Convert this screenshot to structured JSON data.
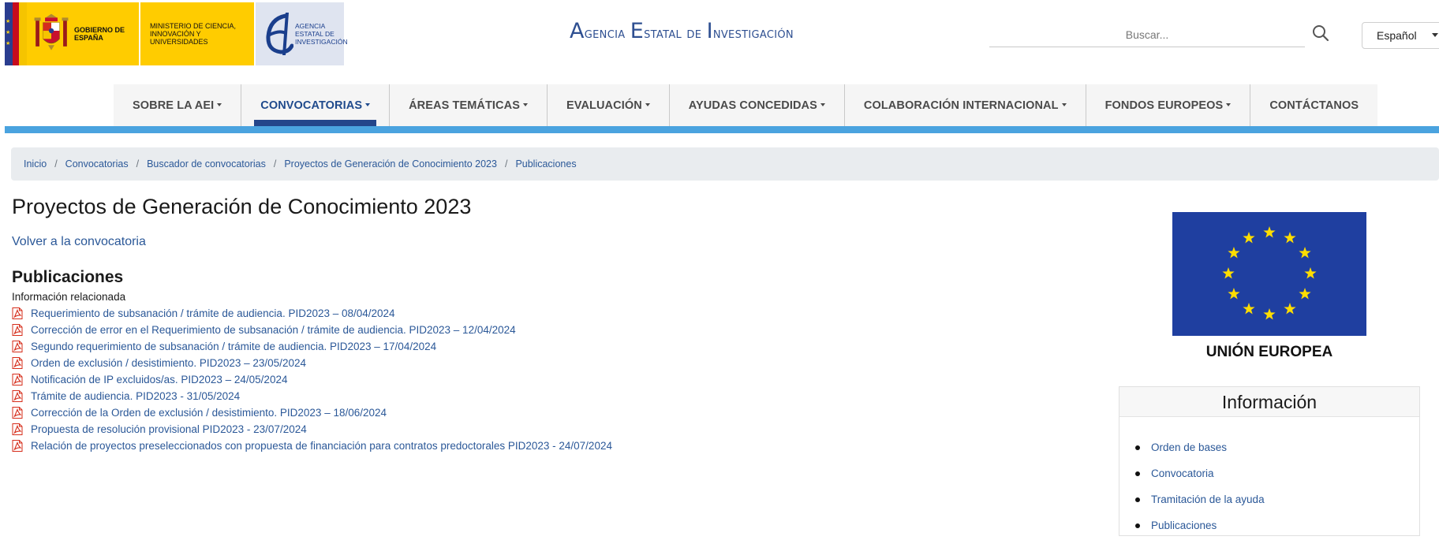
{
  "header": {
    "gobierno_text": "Gobierno de España",
    "ministerio_text": "Ministerio de Ciencia, Innovación y Universidades",
    "aei_logo_text": "Agencia Estatal de Investigación",
    "site_title": {
      "w1_cap": "A",
      "w1_rest": "gencia",
      "w2_cap": "E",
      "w2_rest": "statal",
      "w3": "de",
      "w4_cap": "I",
      "w4_rest": "nvestigación"
    },
    "search_placeholder": "Buscar...",
    "language": "Español"
  },
  "nav": {
    "items": [
      {
        "label": "Sobre la AEI",
        "has_dropdown": true,
        "active": false
      },
      {
        "label": "Convocatorias",
        "has_dropdown": true,
        "active": true
      },
      {
        "label": "Áreas temáticas",
        "has_dropdown": true,
        "active": false
      },
      {
        "label": "Evaluación",
        "has_dropdown": true,
        "active": false
      },
      {
        "label": "Ayudas concedidas",
        "has_dropdown": true,
        "active": false
      },
      {
        "label": "Colaboración internacional",
        "has_dropdown": true,
        "active": false
      },
      {
        "label": "Fondos europeos",
        "has_dropdown": true,
        "active": false
      },
      {
        "label": "Contáctanos",
        "has_dropdown": false,
        "active": false
      }
    ]
  },
  "breadcrumb": [
    "Inicio",
    "Convocatorias",
    "Buscador de convocatorias",
    "Proyectos de Generación de Conocimiento 2023",
    "Publicaciones"
  ],
  "main": {
    "title": "Proyectos de Generación de Conocimiento 2023",
    "back_link": "Volver a la convocatoria",
    "section_title": "Publicaciones",
    "related_label": "Información relacionada",
    "publications": [
      "Requerimiento de subsanación / trámite de audiencia. PID2023 – 08/04/2024",
      "Corrección de error en el Requerimiento de subsanación / trámite de audiencia. PID2023 – 12/04/2024",
      "Segundo requerimiento de subsanación / trámite de audiencia. PID2023 – 17/04/2024",
      "Orden de exclusión / desistimiento. PID2023 – 23/05/2024",
      "Notificación de IP excluidos/as. PID2023 – 24/05/2024",
      "Trámite de audiencia. PID2023 - 31/05/2024",
      "Corrección de la Orden de exclusión / desistimiento. PID2023 – 18/06/2024",
      "Propuesta de resolución provisional PID2023 - 23/07/2024",
      "Relación de proyectos preseleccionados con propuesta de financiación para contratos predoctorales PID2023 - 24/07/2024"
    ]
  },
  "sidebar": {
    "eu_label": "UNIÓN EUROPEA",
    "info_title": "Información",
    "info_links": [
      "Orden de bases",
      "Convocatoria",
      "Tramitación de la ayuda",
      "Publicaciones"
    ]
  },
  "colors": {
    "link": "#2b5898",
    "nav_active": "#24468a",
    "blue_bar": "#4aa3df",
    "eu_blue": "#1f3fa0",
    "eu_star": "#ffdd00",
    "pdf_red": "#d62c1a"
  },
  "icons": {
    "search": "search-icon",
    "pdf": "pdf-icon",
    "dropdown": "chevron-down-icon"
  }
}
